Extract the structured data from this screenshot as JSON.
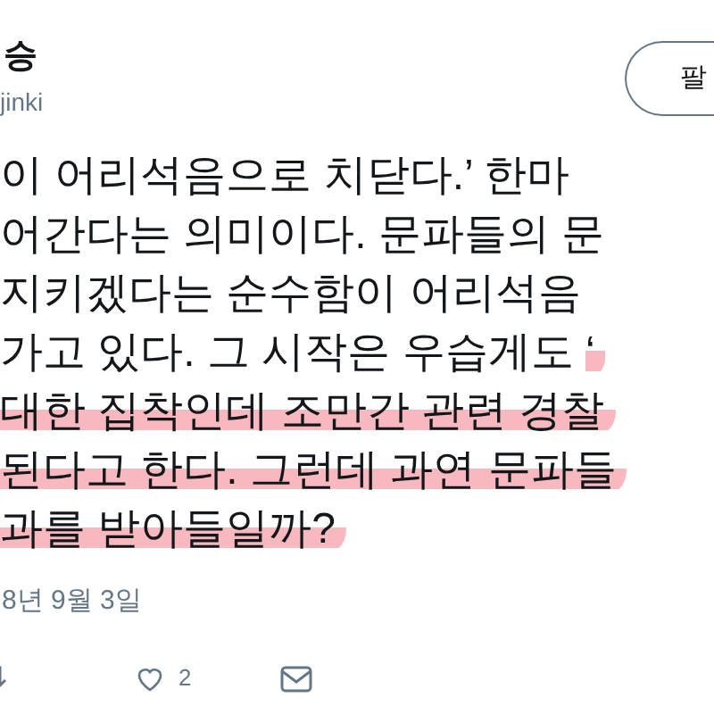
{
  "author": {
    "name": "승",
    "handle": "jinki"
  },
  "follow_button": {
    "label": "팔"
  },
  "tweet_lines": [
    [
      {
        "text": "이 어리석음으로 치닫다.’ 한마",
        "highlighted": false
      }
    ],
    [
      {
        "text": "어간다는 의미이다. 문파들의 문",
        "highlighted": false
      }
    ],
    [
      {
        "text": "지키겠다는 순수함이 어리석음",
        "highlighted": false
      }
    ],
    [
      {
        "text": "가고 있다. 그 시작은 우습게도 ",
        "highlighted": false
      },
      {
        "text": "‘",
        "highlighted": true
      }
    ],
    [
      {
        "text": "대한 집착인데 조만간 관련 경찰",
        "highlighted": true
      }
    ],
    [
      {
        "text": "된다고 한다. 그런데 과연 문파들",
        "highlighted": true
      }
    ],
    [
      {
        "text": "과를 받아들일까?",
        "highlighted": true
      }
    ]
  ],
  "date": "8년 9월 3일",
  "actions": {
    "like_count": "2"
  }
}
